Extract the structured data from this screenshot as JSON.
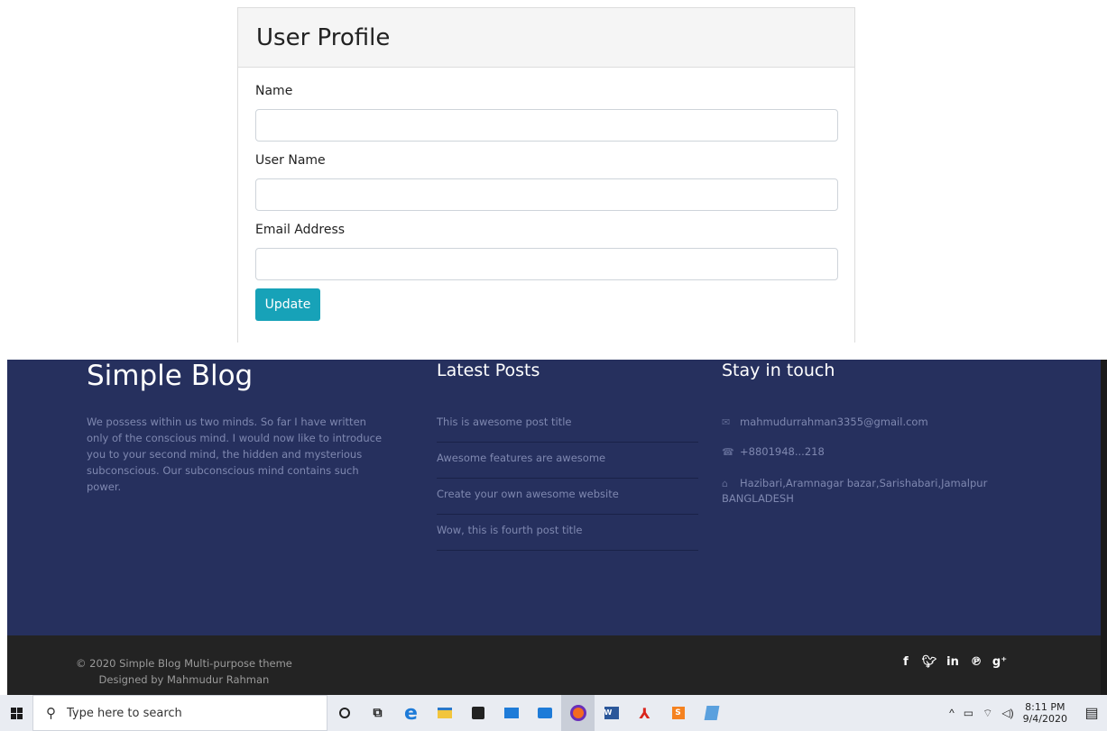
{
  "profile": {
    "title": "User Profile",
    "fields": [
      {
        "label": "Name",
        "value": "",
        "placeholder": ""
      },
      {
        "label": "User Name",
        "value": "",
        "placeholder": ""
      },
      {
        "label": "Email Address",
        "value": "",
        "placeholder": ""
      }
    ],
    "submit_label": "Update"
  },
  "footer": {
    "brand": "Simple Blog",
    "about": "We possess within us two minds. So far I have written only of the conscious mind. I would now like to introduce you to your second mind, the hidden and mysterious subconscious. Our subconscious mind contains such power.",
    "latest_posts_title": "Latest Posts",
    "posts": [
      "This is awesome post title",
      "Awesome features are awesome",
      "Create your own awesome website",
      "Wow, this is fourth post title"
    ],
    "stay_title": "Stay in touch",
    "email": "mahmudurrahman3355@gmail.com",
    "phone": "+8801948...218",
    "address": "Hazibari,Aramnagar bazar,Sarishabari,Jamalpur BANGLADESH",
    "copyright": "© 2020 Simple Blog Multi-purpose theme",
    "designer": "Designed by Mahmudur Rahman",
    "social": [
      "f",
      "y",
      "in",
      "p",
      "g+"
    ]
  },
  "taskbar": {
    "search_placeholder": "Type here to search",
    "time": "8:11 PM",
    "date": "9/4/2020"
  },
  "colors": {
    "footer_bg": "#26305e",
    "footer_bottom_bg": "#232323",
    "button_bg": "#17a2b8"
  }
}
